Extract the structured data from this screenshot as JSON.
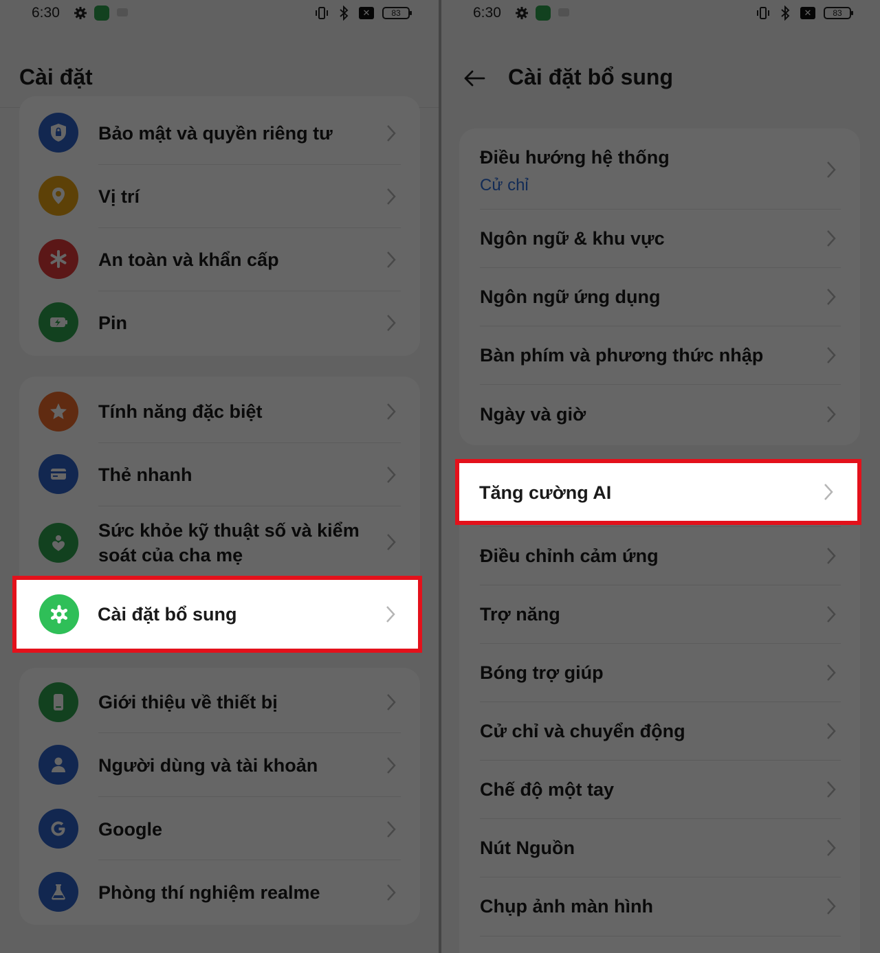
{
  "status_bar": {
    "time": "6:30",
    "battery": "83",
    "x_badge": "✕"
  },
  "left": {
    "title": "Cài đặt",
    "groups": [
      {
        "items": [
          {
            "label": "Bảo mật và quyền riêng tư",
            "icon": "shield-lock-icon",
            "color": "#2f63c9"
          },
          {
            "label": "Vị trí",
            "icon": "location-pin-icon",
            "color": "#e9a413"
          },
          {
            "label": "An toàn và khẩn cấp",
            "icon": "asterisk-icon",
            "color": "#e33b3b"
          },
          {
            "label": "Pin",
            "icon": "battery-icon",
            "color": "#2fa44f"
          }
        ]
      },
      {
        "items": [
          {
            "label": "Tính năng đặc biệt",
            "icon": "star-icon",
            "color": "#ef6b2b"
          },
          {
            "label": "Thẻ nhanh",
            "icon": "card-icon",
            "color": "#2f63c9"
          },
          {
            "label": "Sức khỏe kỹ thuật số và kiểm soát của cha mẹ",
            "icon": "person-heart-icon",
            "color": "#2fa44f"
          },
          {
            "label": "Cài đặt bổ sung",
            "icon": "gear-icon",
            "color": "#2fbf58"
          }
        ]
      },
      {
        "items": [
          {
            "label": "Giới thiệu về thiết bị",
            "icon": "phone-device-icon",
            "color": "#2fa44f"
          },
          {
            "label": "Người dùng và tài khoản",
            "icon": "user-icon",
            "color": "#2f63c9"
          },
          {
            "label": "Google",
            "icon": "google-icon",
            "color": "#2f63c9"
          },
          {
            "label": "Phòng thí nghiệm realme",
            "icon": "flask-icon",
            "color": "#2f63c9"
          }
        ]
      }
    ]
  },
  "right": {
    "title": "Cài đặt bổ sung",
    "group1": [
      {
        "label": "Điều hướng hệ thống",
        "sub": "Cử chỉ"
      },
      {
        "label": "Ngôn ngữ & khu vực"
      },
      {
        "label": "Ngôn ngữ ứng dụng"
      },
      {
        "label": "Bàn phím và phương thức nhập"
      },
      {
        "label": "Ngày và giờ"
      }
    ],
    "group2": [
      {
        "label": "Tăng cường AI"
      },
      {
        "label": "Điều chỉnh cảm ứng"
      },
      {
        "label": "Trợ năng"
      },
      {
        "label": "Bóng trợ giúp"
      },
      {
        "label": "Cử chỉ và chuyển động"
      },
      {
        "label": "Chế độ một tay"
      },
      {
        "label": "Nút Nguồn"
      },
      {
        "label": "Chụp ảnh màn hình"
      }
    ]
  },
  "colors": {
    "highlight": "#e3111b",
    "link": "#2d6bd6"
  }
}
